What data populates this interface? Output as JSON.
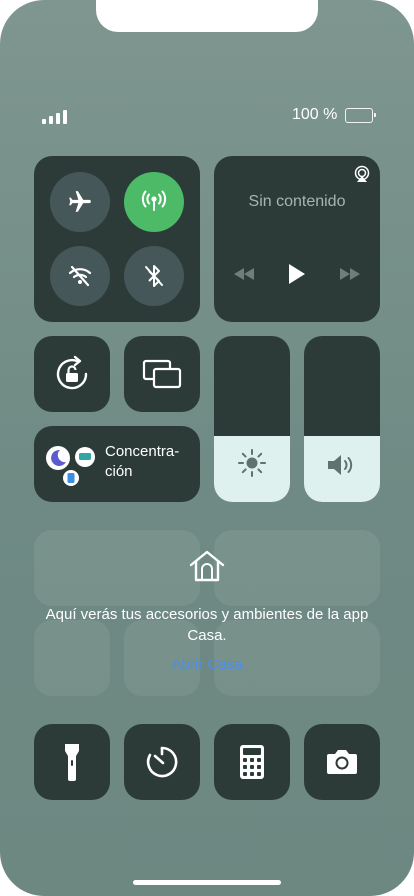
{
  "status": {
    "battery_text": "100 %",
    "battery_level": 1.0
  },
  "connectivity": {
    "airplane_mode": false,
    "cellular_data": true,
    "wifi": false,
    "bluetooth": false,
    "icons": [
      "airplane-icon",
      "cellular-antenna-icon",
      "wifi-off-icon",
      "bluetooth-off-icon"
    ]
  },
  "media": {
    "title": "Sin contenido",
    "icons": [
      "airplay-icon",
      "rewind-icon",
      "play-icon",
      "fast-forward-icon"
    ]
  },
  "focus": {
    "label": "Concentra-\nción"
  },
  "sliders": {
    "brightness_level": 0.4,
    "volume_level": 0.4
  },
  "home": {
    "message": "Aquí verás tus accesorios y ambientes de la app Casa.",
    "link_label": "Abrir Casa"
  },
  "colors": {
    "active_green": "#4cba67",
    "link_blue": "#4b8fe8",
    "tile_dark": "#2c3b38",
    "slider_fill": "#dff1ee"
  },
  "bottom_row": [
    "flashlight-icon",
    "timer-icon",
    "calculator-icon",
    "camera-icon"
  ]
}
